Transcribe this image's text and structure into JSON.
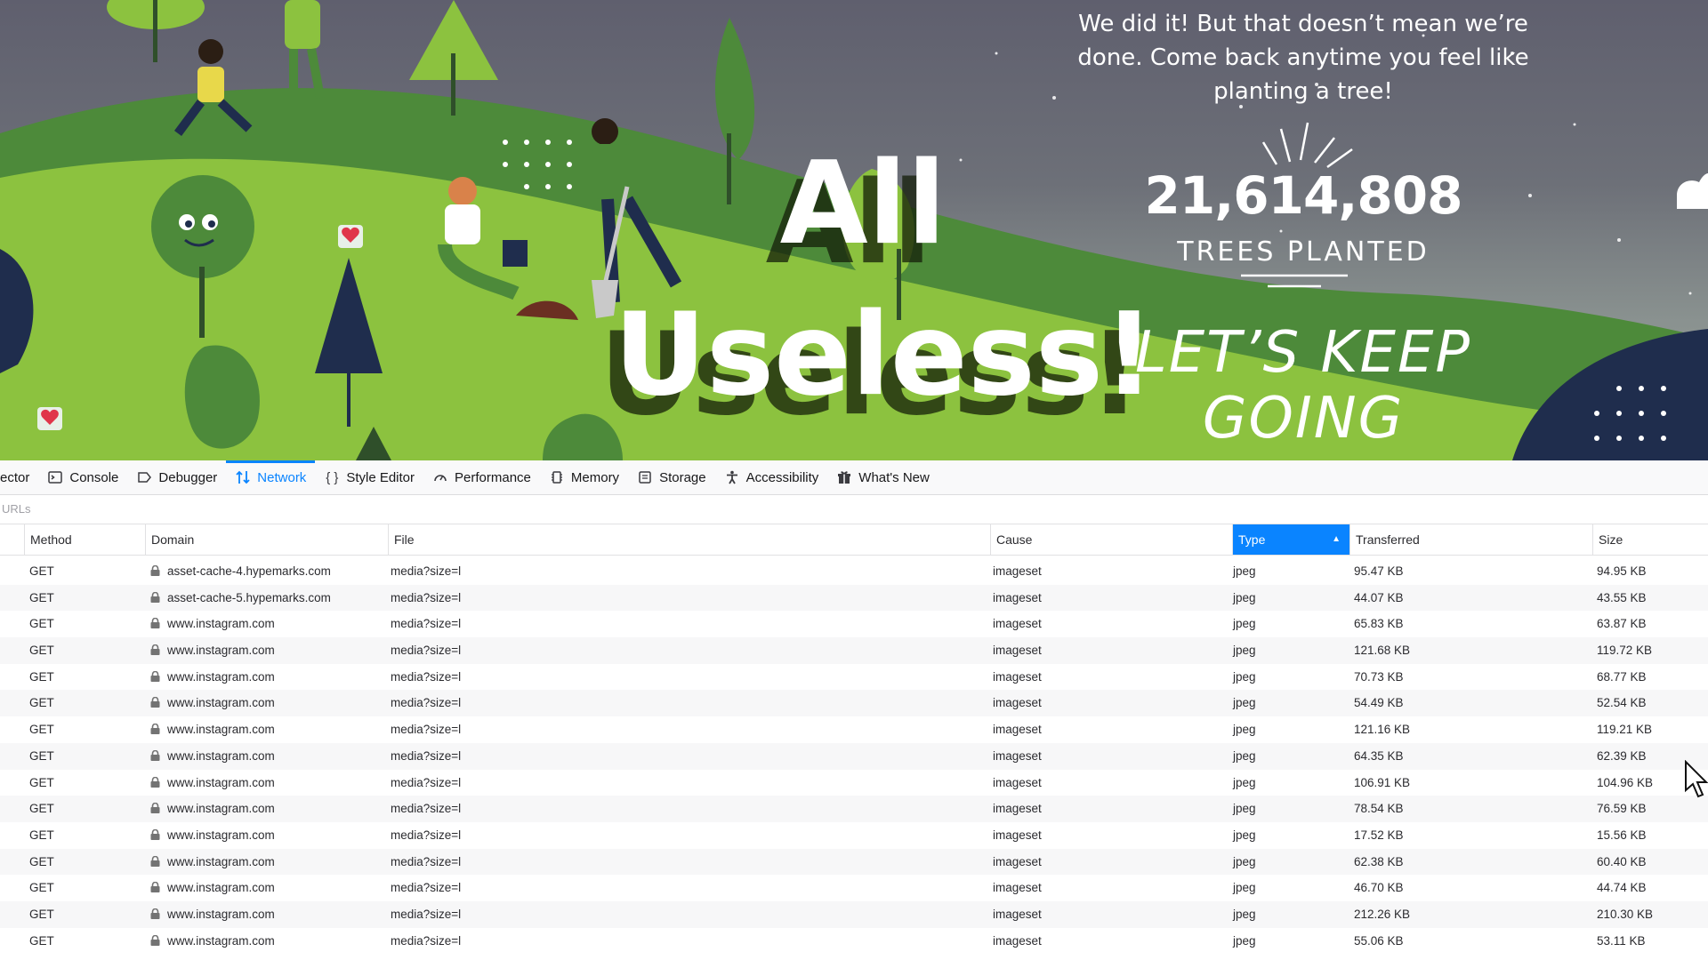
{
  "banner": {
    "message": "We did it! But that doesn’t mean we’re done. Come back anytime you feel like planting a tree!",
    "count": "21,614,808",
    "count_label": "TREES PLANTED",
    "cta_line1": "LET’S KEEP",
    "cta_line2": "GOING"
  },
  "overlay": {
    "line1": "All",
    "line2": "Useless!"
  },
  "devtools": {
    "tabs": [
      {
        "label": "ector",
        "icon": "inspector-icon"
      },
      {
        "label": "Console",
        "icon": "console-icon"
      },
      {
        "label": "Debugger",
        "icon": "debugger-icon"
      },
      {
        "label": "Network",
        "icon": "network-icon",
        "active": true
      },
      {
        "label": "Style Editor",
        "icon": "braces-icon"
      },
      {
        "label": "Performance",
        "icon": "gauge-icon"
      },
      {
        "label": "Memory",
        "icon": "memory-chip-icon"
      },
      {
        "label": "Storage",
        "icon": "storage-icon"
      },
      {
        "label": "Accessibility",
        "icon": "accessibility-icon"
      },
      {
        "label": "What's New",
        "icon": "gift-icon"
      }
    ],
    "filter_placeholder": "URLs",
    "columns": {
      "method": "Method",
      "domain": "Domain",
      "file": "File",
      "cause": "Cause",
      "type": "Type",
      "transferred": "Transferred",
      "size": "Size"
    },
    "sorted_column": "type",
    "accent_color": "#0a84ff",
    "requests": [
      {
        "method": "GET",
        "domain": "asset-cache-4.hypemarks.com",
        "file": "media?size=l",
        "cause": "imageset",
        "type": "jpeg",
        "transferred": "95.47 KB",
        "size": "94.95 KB"
      },
      {
        "method": "GET",
        "domain": "asset-cache-5.hypemarks.com",
        "file": "media?size=l",
        "cause": "imageset",
        "type": "jpeg",
        "transferred": "44.07 KB",
        "size": "43.55 KB"
      },
      {
        "method": "GET",
        "domain": "www.instagram.com",
        "file": "media?size=l",
        "cause": "imageset",
        "type": "jpeg",
        "transferred": "65.83 KB",
        "size": "63.87 KB"
      },
      {
        "method": "GET",
        "domain": "www.instagram.com",
        "file": "media?size=l",
        "cause": "imageset",
        "type": "jpeg",
        "transferred": "121.68 KB",
        "size": "119.72 KB"
      },
      {
        "method": "GET",
        "domain": "www.instagram.com",
        "file": "media?size=l",
        "cause": "imageset",
        "type": "jpeg",
        "transferred": "70.73 KB",
        "size": "68.77 KB"
      },
      {
        "method": "GET",
        "domain": "www.instagram.com",
        "file": "media?size=l",
        "cause": "imageset",
        "type": "jpeg",
        "transferred": "54.49 KB",
        "size": "52.54 KB"
      },
      {
        "method": "GET",
        "domain": "www.instagram.com",
        "file": "media?size=l",
        "cause": "imageset",
        "type": "jpeg",
        "transferred": "121.16 KB",
        "size": "119.21 KB"
      },
      {
        "method": "GET",
        "domain": "www.instagram.com",
        "file": "media?size=l",
        "cause": "imageset",
        "type": "jpeg",
        "transferred": "64.35 KB",
        "size": "62.39 KB"
      },
      {
        "method": "GET",
        "domain": "www.instagram.com",
        "file": "media?size=l",
        "cause": "imageset",
        "type": "jpeg",
        "transferred": "106.91 KB",
        "size": "104.96 KB"
      },
      {
        "method": "GET",
        "domain": "www.instagram.com",
        "file": "media?size=l",
        "cause": "imageset",
        "type": "jpeg",
        "transferred": "78.54 KB",
        "size": "76.59 KB"
      },
      {
        "method": "GET",
        "domain": "www.instagram.com",
        "file": "media?size=l",
        "cause": "imageset",
        "type": "jpeg",
        "transferred": "17.52 KB",
        "size": "15.56 KB"
      },
      {
        "method": "GET",
        "domain": "www.instagram.com",
        "file": "media?size=l",
        "cause": "imageset",
        "type": "jpeg",
        "transferred": "62.38 KB",
        "size": "60.40 KB"
      },
      {
        "method": "GET",
        "domain": "www.instagram.com",
        "file": "media?size=l",
        "cause": "imageset",
        "type": "jpeg",
        "transferred": "46.70 KB",
        "size": "44.74 KB"
      },
      {
        "method": "GET",
        "domain": "www.instagram.com",
        "file": "media?size=l",
        "cause": "imageset",
        "type": "jpeg",
        "transferred": "212.26 KB",
        "size": "210.30 KB"
      },
      {
        "method": "GET",
        "domain": "www.instagram.com",
        "file": "media?size=l",
        "cause": "imageset",
        "type": "jpeg",
        "transferred": "55.06 KB",
        "size": "53.11 KB"
      }
    ]
  }
}
